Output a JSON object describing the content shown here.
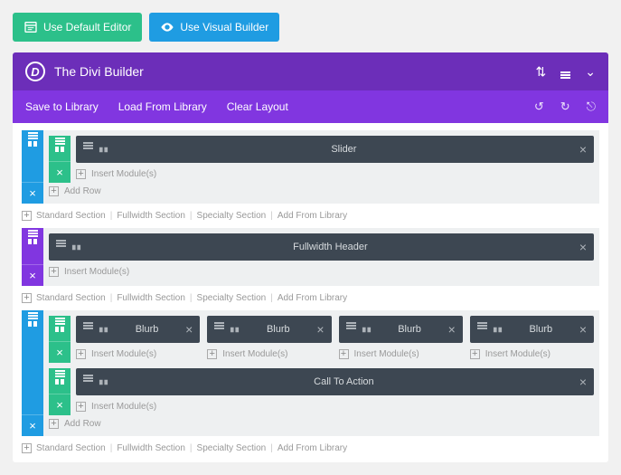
{
  "topButtons": {
    "defaultEditor": "Use Default Editor",
    "visualBuilder": "Use Visual Builder"
  },
  "header": {
    "logoLetter": "D",
    "title": "The Divi Builder"
  },
  "subheader": {
    "saveLibrary": "Save to Library",
    "loadLibrary": "Load From Library",
    "clearLayout": "Clear Layout"
  },
  "labels": {
    "insertModule": "Insert Module(s)",
    "addRow": "Add Row",
    "standardSection": "Standard Section",
    "fullwidthSection": "Fullwidth Section",
    "specialtySection": "Specialty Section",
    "addFromLibrary": "Add From Library"
  },
  "sections": [
    {
      "type": "standard",
      "rows": [
        {
          "modules": [
            {
              "title": "Slider"
            }
          ]
        }
      ]
    },
    {
      "type": "fullwidth",
      "modules": [
        {
          "title": "Fullwidth Header"
        }
      ]
    },
    {
      "type": "standard",
      "rows": [
        {
          "modules": [
            {
              "title": "Blurb"
            },
            {
              "title": "Blurb"
            },
            {
              "title": "Blurb"
            },
            {
              "title": "Blurb"
            }
          ]
        },
        {
          "modules": [
            {
              "title": "Call To Action"
            }
          ]
        }
      ]
    }
  ]
}
